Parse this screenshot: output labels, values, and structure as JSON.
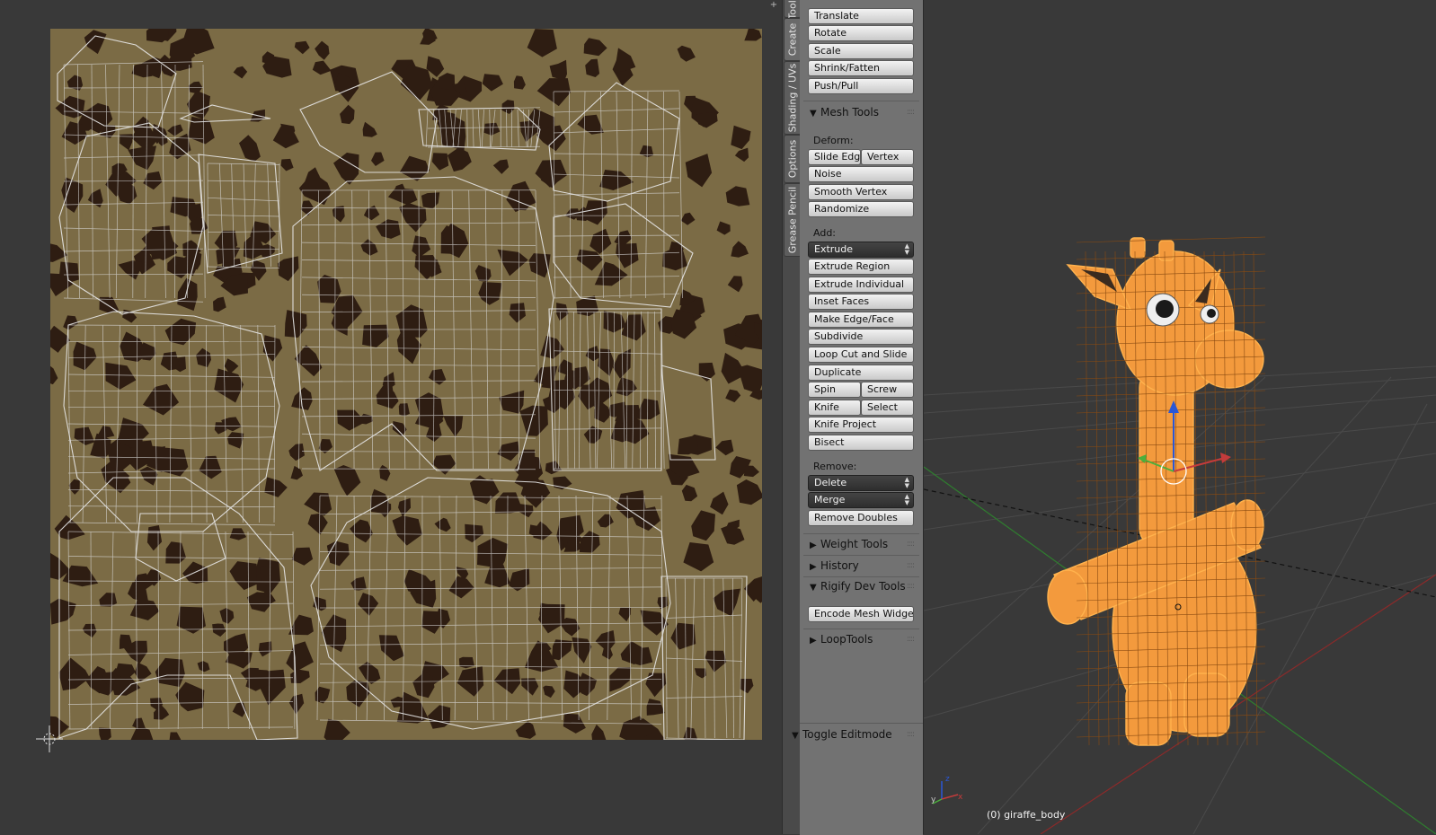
{
  "uv_editor": {
    "corner_button_icon": "plus-icon"
  },
  "tabs": [
    {
      "label": "Tools"
    },
    {
      "label": "Create"
    },
    {
      "label": "Shading / UVs"
    },
    {
      "label": "Options"
    },
    {
      "label": "Grease Pencil"
    }
  ],
  "transform_buttons": [
    "Translate",
    "Rotate",
    "Scale",
    "Shrink/Fatten",
    "Push/Pull"
  ],
  "mesh_tools": {
    "title": "Mesh Tools",
    "deform_label": "Deform:",
    "deform": {
      "slide_edge": "Slide Edg",
      "vertex": "Vertex",
      "noise": "Noise",
      "smooth_vertex": "Smooth Vertex",
      "randomize": "Randomize"
    },
    "add_label": "Add:",
    "add": {
      "extrude": "Extrude",
      "extrude_region": "Extrude Region",
      "extrude_individual": "Extrude Individual",
      "inset_faces": "Inset Faces",
      "make_edge_face": "Make Edge/Face",
      "subdivide": "Subdivide",
      "loop_cut": "Loop Cut and Slide",
      "duplicate": "Duplicate",
      "spin": "Spin",
      "screw": "Screw",
      "knife": "Knife",
      "select": "Select",
      "knife_project": "Knife Project",
      "bisect": "Bisect"
    },
    "remove_label": "Remove:",
    "remove": {
      "delete": "Delete",
      "merge": "Merge",
      "remove_doubles": "Remove Doubles"
    }
  },
  "panels": {
    "weight_tools": "Weight Tools",
    "history": "History",
    "rigify": "Rigify Dev Tools",
    "rigify_button": "Encode Mesh Widge...",
    "looptools": "LoopTools",
    "toggle_editmode": "Toggle Editmode"
  },
  "viewport": {
    "object_label": "(0) giraffe_body",
    "mesh_color": "#f5901f",
    "selection_color": "#ff9a2e"
  },
  "colors": {
    "texture_bg": "#7b6b45",
    "texture_spot": "#2e1d12",
    "panel": "#727272",
    "viewport_bg": "#393939",
    "axis_red": "#c43b3b",
    "axis_green": "#4caf3c",
    "axis_blue": "#2a57d6"
  }
}
